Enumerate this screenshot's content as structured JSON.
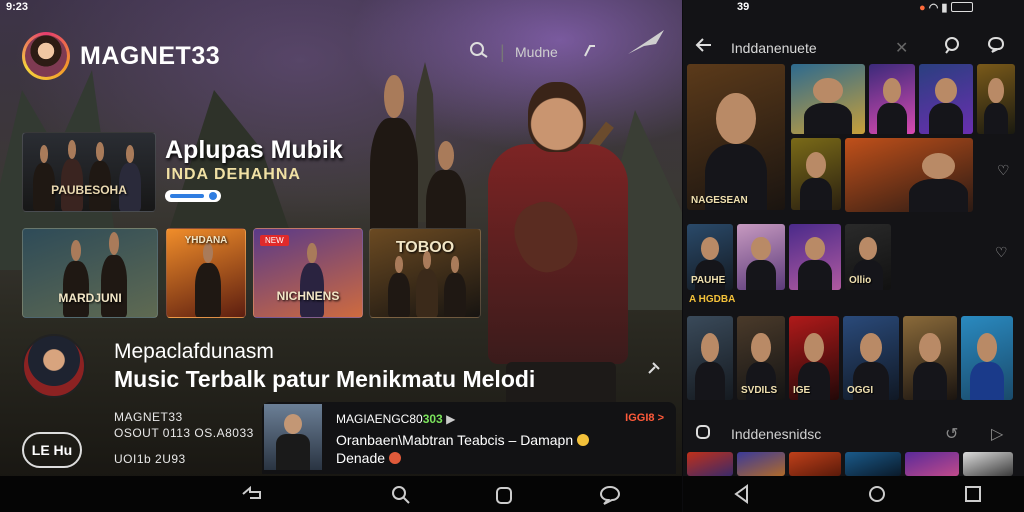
{
  "left": {
    "status_time": "9:23",
    "app_title": "MAGNET33",
    "header_text": "Mudne",
    "hero": {
      "title": "Aplupas Mubik",
      "subtitle": "INDA DEHAHNA",
      "poster_caption": "PAUBESOHA"
    },
    "cards": [
      {
        "caption": "MARDJUNI",
        "colors": [
          "#2e4b58",
          "#5f6a52"
        ]
      },
      {
        "caption": "YHDANA",
        "colors": [
          "#f08d2a",
          "#5d1e10"
        ]
      },
      {
        "caption": "NICHNENS",
        "colors": [
          "#5a3a88",
          "#ce6b3f"
        ]
      },
      {
        "caption": "TOBOO",
        "colors": [
          "#6b4a22",
          "#171411"
        ]
      }
    ],
    "card3_badge": "NEW",
    "artist": {
      "name": "Mepaclafdunasm",
      "tagline": "Music Terbalk patur Menikmatu Melodi",
      "channel": "MAGNET33",
      "meta_line1": "OSOUT 0113 OS.A8033",
      "meta_line2": "UOI1b 2U93"
    },
    "badge_label": "LE Hu",
    "mini_player": {
      "title_prefix": "MAGIAENGC80",
      "title_highlight": "303",
      "tag": "IGGI8 >",
      "line1": "Oranbaen\\Mabtran Teabcis – Damapn",
      "line2": "Denade"
    },
    "nav_icons": [
      "back-icon",
      "search-icon",
      "home-icon",
      "chat-icon"
    ]
  },
  "right": {
    "status_left": "39",
    "header_title": "Inddanenuete",
    "section_title": "Inddenesnidsc",
    "row1": [
      {
        "caption": "NAGESEAN",
        "colors": [
          "#5b3a1a",
          "#1a1410"
        ]
      },
      {
        "caption": "",
        "colors": [
          "#2d6a8f",
          "#c8a03a"
        ]
      },
      {
        "caption": "",
        "colors": [
          "#3b2a7a",
          "#d84ab0"
        ]
      },
      {
        "caption": "",
        "colors": [
          "#2a3f7f",
          "#6a2fb0"
        ]
      },
      {
        "caption": "",
        "colors": [
          "#7a5a1a",
          "#1a1a10"
        ]
      }
    ],
    "row2": [
      {
        "caption": "",
        "colors": [
          "#7a6a18",
          "#2a2010"
        ]
      },
      {
        "caption": "",
        "colors": [
          "#c0501a",
          "#2a1a14"
        ]
      }
    ],
    "row3": [
      {
        "caption": "PAUHE",
        "colors": [
          "#2a4a6a",
          "#141a22"
        ]
      },
      {
        "caption": "",
        "colors": [
          "#c79ac0",
          "#5b3a7a"
        ]
      },
      {
        "caption": "",
        "colors": [
          "#4a2a8a",
          "#b05aa0"
        ]
      },
      {
        "caption": "Ollio",
        "colors": [
          "#2a2a2a",
          "#111"
        ]
      }
    ],
    "row3_footer": "A HGDBA",
    "row4": [
      {
        "caption": "",
        "colors": [
          "#3a4a5a",
          "#151a20"
        ]
      },
      {
        "caption": "SVDILS",
        "colors": [
          "#4a3a2a",
          "#141414"
        ]
      },
      {
        "caption": "IGE",
        "colors": [
          "#b01a1a",
          "#220808"
        ]
      },
      {
        "caption": "OGGI",
        "colors": [
          "#2a4a7a",
          "#101824"
        ]
      },
      {
        "caption": "",
        "colors": [
          "#8a6a3a",
          "#1a1410"
        ]
      },
      {
        "caption": "",
        "colors": [
          "#2a8ac0",
          "#1a4a6a"
        ]
      }
    ],
    "row5": [
      {
        "colors": [
          "#c0301a",
          "#3a2a6a"
        ]
      },
      {
        "colors": [
          "#3a3a9a",
          "#b06a2a"
        ]
      },
      {
        "colors": [
          "#c0401a",
          "#5a1a0a"
        ]
      },
      {
        "colors": [
          "#1a5a8a",
          "#0a1a2a"
        ]
      },
      {
        "colors": [
          "#5a2a9a",
          "#c04a8a"
        ]
      },
      {
        "colors": [
          "#dcdcdc",
          "#3a3a3a"
        ]
      }
    ]
  }
}
